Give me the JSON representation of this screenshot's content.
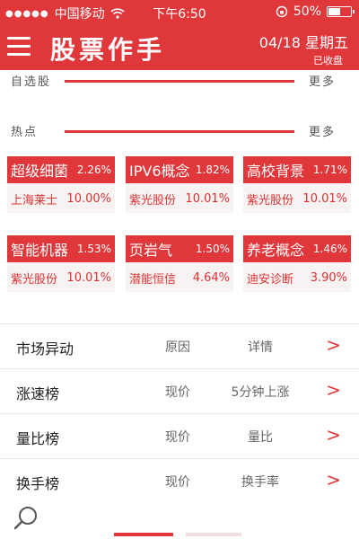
{
  "status_bar": {
    "carrier": "中国移动",
    "time": "下午6:50",
    "battery": "50%"
  },
  "header": {
    "title": "股票作手",
    "date": "04/18 星期五",
    "market_status": "已收盘"
  },
  "watchlist_section": {
    "title": "自选股",
    "more": "更多"
  },
  "hot_section": {
    "title": "热点",
    "more": "更多"
  },
  "hot_tiles": [
    {
      "sector": "超级细菌",
      "change": "2.26%",
      "stock": "上海莱士",
      "stock_change": "10.00%"
    },
    {
      "sector": "IPV6概念",
      "change": "1.82%",
      "stock": "紫光股份",
      "stock_change": "10.01%"
    },
    {
      "sector": "高校背景",
      "change": "1.71%",
      "stock": "紫光股份",
      "stock_change": "10.01%"
    },
    {
      "sector": "智能机器",
      "change": "1.53%",
      "stock": "紫光股份",
      "stock_change": "10.01%"
    },
    {
      "sector": "页岩气",
      "change": "1.50%",
      "stock": "潜能恒信",
      "stock_change": "4.64%"
    },
    {
      "sector": "养老概念",
      "change": "1.46%",
      "stock": "迪安诊断",
      "stock_change": "3.90%"
    }
  ],
  "rank_list": [
    {
      "name": "市场异动",
      "col1": "原因",
      "col2": "详情",
      "arrow": ">"
    },
    {
      "name": "涨速榜",
      "col1": "现价",
      "col2": "5分钟上涨",
      "arrow": ">"
    },
    {
      "name": "量比榜",
      "col1": "现价",
      "col2": "量比",
      "arrow": ">"
    },
    {
      "name": "换手榜",
      "col1": "现价",
      "col2": "换手率",
      "arrow": ">"
    }
  ],
  "colors": {
    "accent": "#e0373b"
  }
}
